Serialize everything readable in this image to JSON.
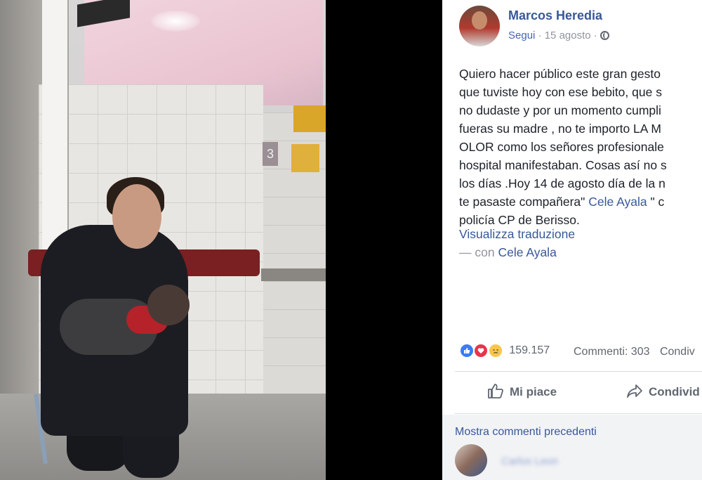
{
  "post": {
    "author": "Marcos Heredia",
    "follow_label": "Segui",
    "date": "15 agosto",
    "privacy_icon": "globe-icon",
    "body_lines": [
      "Quiero hacer público este gran gesto",
      "que tuviste hoy con ese bebito, que s",
      "no dudaste y por un momento cumpli",
      "fueras su madre , no te importo LA M",
      "OLOR como los señores profesionale",
      "hospital manifestaban. Cosas así no s",
      "los días .Hoy 14 de agosto día de la n"
    ],
    "line8_pre": "te pasaste compañera\" ",
    "line8_link": "Cele Ayala",
    "line8_post": " \" c",
    "line9": "policía CP de Berisso.",
    "translate_label": "Visualizza traduzione",
    "with_prefix": "— con",
    "with_name": "Cele Ayala"
  },
  "stats": {
    "reactions_count": "159.157",
    "comments_label": "Commenti: 303",
    "shares_label": "Condiv"
  },
  "actions": {
    "like_label": "Mi piace",
    "share_label": "Condivid"
  },
  "comments": {
    "more_label": "Mostra commenti precedenti",
    "commenter_name": "Carlos Leon"
  },
  "colors": {
    "link": "#385898",
    "meta": "#90949c",
    "like": "#3b7cf3",
    "love": "#e9334c",
    "sad": "#f7c64b"
  }
}
